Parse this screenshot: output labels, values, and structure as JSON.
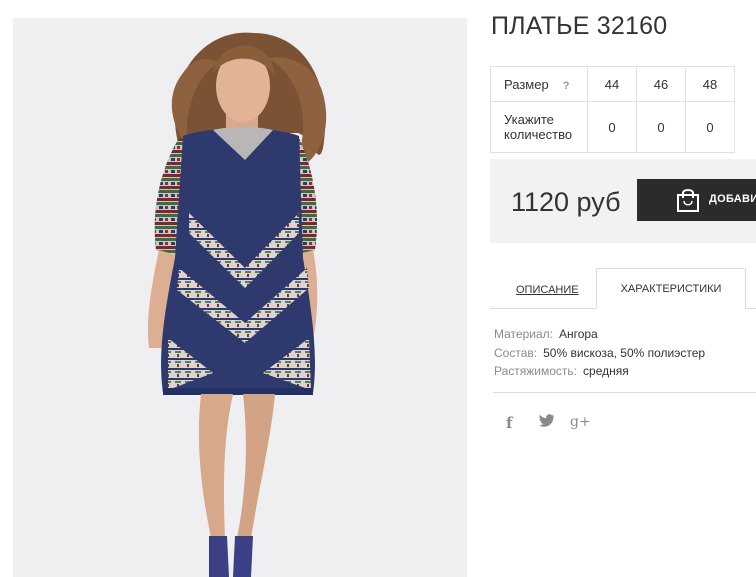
{
  "product": {
    "title": "ПЛАТЬЕ 32160",
    "image": "product-photo-dress"
  },
  "size_table": {
    "size_label": "Размер",
    "help_label": "?",
    "quantity_label_line1": "Укажите",
    "quantity_label_line2": "количество",
    "sizes": [
      "44",
      "46",
      "48"
    ],
    "quantities": [
      "0",
      "0",
      "0"
    ]
  },
  "buy": {
    "price": "1120 руб",
    "add_button_label": "ДОБАВИ",
    "button_icon": "shopping-bag-icon"
  },
  "tabs": {
    "description": "ОПИСАНИЕ",
    "characteristics": "ХАРАКТЕРИСТИКИ",
    "active": "characteristics"
  },
  "characteristics": [
    {
      "key": "Материал:",
      "value": "Ангора"
    },
    {
      "key": "Состав:",
      "value": "50% вискоза, 50% полиэстер"
    },
    {
      "key": "Растяжимость:",
      "value": "средняя"
    }
  ],
  "social": {
    "facebook": "f",
    "googleplus": "g+",
    "icons": [
      "facebook-icon",
      "twitter-icon",
      "google-plus-icon"
    ]
  },
  "colors": {
    "button_bg": "#2b2b2b",
    "buybox_bg": "#f2f2f2",
    "dress_navy": "#2e3a6e"
  }
}
